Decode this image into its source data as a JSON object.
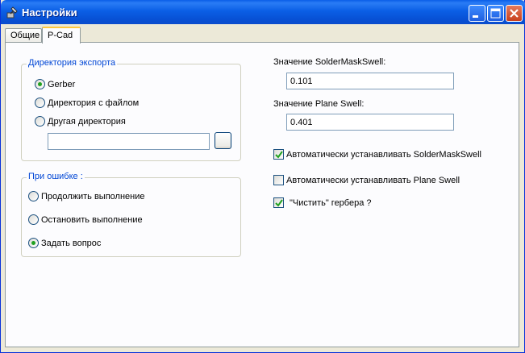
{
  "window": {
    "title": "Настройки"
  },
  "tabs": [
    {
      "label": "Общие",
      "selected": false
    },
    {
      "label": "P-Cad",
      "selected": true
    }
  ],
  "export_dir": {
    "legend": "Директория экспорта",
    "options": [
      {
        "label": "Gerber",
        "checked": true
      },
      {
        "label": "Директория с файлом",
        "checked": false
      },
      {
        "label": "Другая директория",
        "checked": false
      }
    ],
    "path_value": ""
  },
  "on_error": {
    "legend": "При ошибке :",
    "options": [
      {
        "label": "Продолжить выполнение",
        "checked": false
      },
      {
        "label": "Остановить выполнение",
        "checked": false
      },
      {
        "label": "Задать вопрос",
        "checked": true
      }
    ]
  },
  "solder_mask": {
    "label": "Значение SolderMaskSwell:",
    "value": "0.101"
  },
  "plane_swell": {
    "label": "Значение Plane Swell:",
    "value": "0.401"
  },
  "checkboxes": [
    {
      "label": "Автоматически устанавливать SolderMaskSwell",
      "checked": true
    },
    {
      "label": "Автоматически устанавливать Plane Swell",
      "checked": false
    },
    {
      "label": "\"Чистить\" гербера ?",
      "checked": true
    }
  ],
  "colors": {
    "titlebar": "#0a5ee8",
    "legend_text": "#0046d5",
    "radio_dot": "#21a121",
    "checkmark": "#21a121",
    "tab_highlight": "#ffc83c"
  }
}
